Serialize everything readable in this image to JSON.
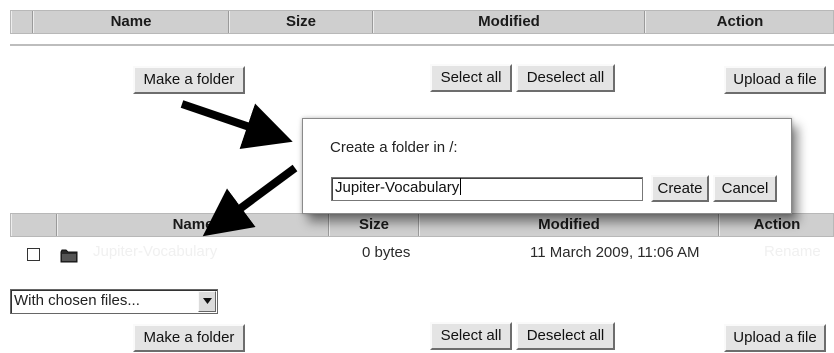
{
  "table_header": {
    "columns": [
      "Name",
      "Size",
      "Modified",
      "Action"
    ]
  },
  "toolbar_top": {
    "make_folder": "Make a folder",
    "select_all": "Select all",
    "deselect_all": "Deselect all",
    "upload_file": "Upload a file"
  },
  "dialog": {
    "title": "Create a folder in /:",
    "input_value": "Jupiter-Vocabulary",
    "create_label": "Create",
    "cancel_label": "Cancel"
  },
  "table_header_lower": {
    "columns": [
      "Name",
      "Size",
      "Modified",
      "Action"
    ]
  },
  "file_row": {
    "name": "Jupiter-Vocabulary",
    "size": "0 bytes",
    "modified": "11 March 2009, 11:06 AM",
    "action": "Rename",
    "icon": "folder-icon"
  },
  "chosen_files": {
    "selected": "With chosen files..."
  },
  "toolbar_bottom": {
    "make_folder": "Make a folder",
    "select_all": "Select all",
    "deselect_all": "Deselect all",
    "upload_file": "Upload a file"
  }
}
